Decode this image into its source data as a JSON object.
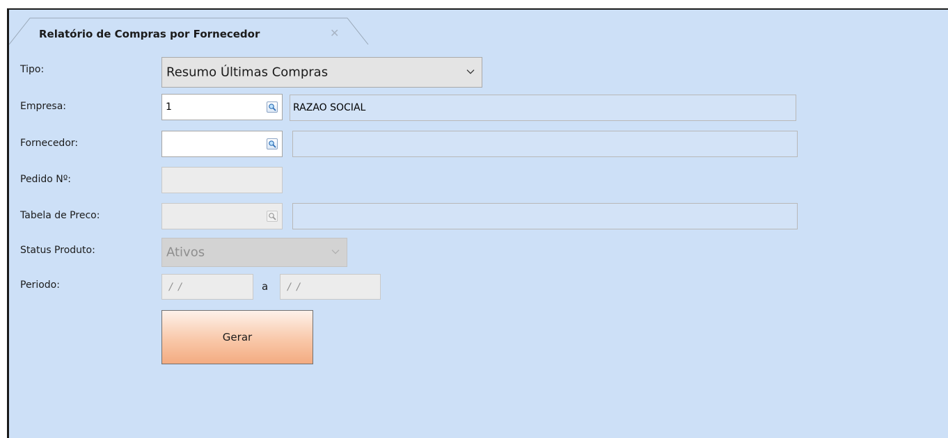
{
  "tab": {
    "title": "Relatório de Compras por Fornecedor",
    "close_glyph": "✕"
  },
  "form": {
    "tipo": {
      "label": "Tipo:",
      "value": "Resumo Últimas Compras"
    },
    "empresa": {
      "label": "Empresa:",
      "code": "1",
      "description": "RAZAO SOCIAL"
    },
    "fornecedor": {
      "label": "Fornecedor:",
      "code": "",
      "description": ""
    },
    "pedido": {
      "label": "Pedido Nº:",
      "value": ""
    },
    "tabela_preco": {
      "label": "Tabela de Preco:",
      "code": "",
      "description": ""
    },
    "status_produto": {
      "label": "Status Produto:",
      "value": "Ativos"
    },
    "periodo": {
      "label": "Periodo:",
      "from": "/ /",
      "separator": "a",
      "to": "/ /"
    }
  },
  "actions": {
    "generate_label": "Gerar"
  },
  "icons": {
    "lookup": "magnifier-icon",
    "dropdown": "chevron-down-icon",
    "close": "close-icon"
  },
  "colors": {
    "panel_bg": "#cde0f7",
    "button_gradient_bottom": "#f3ab81"
  }
}
